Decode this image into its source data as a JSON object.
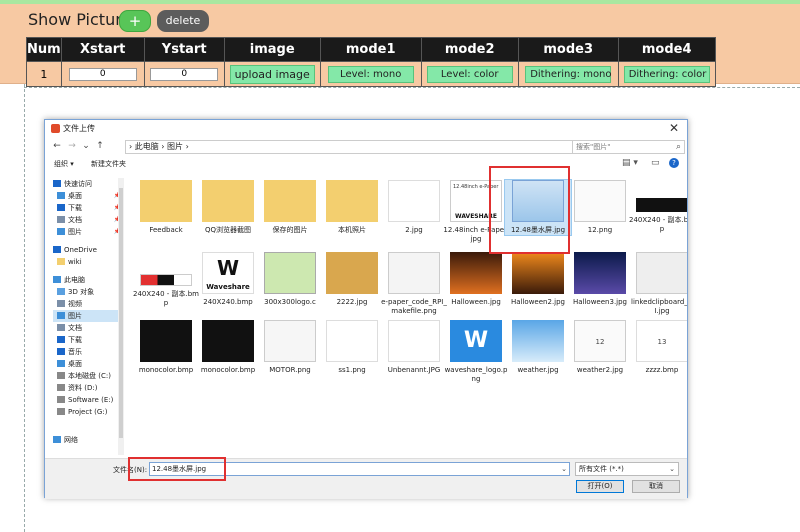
{
  "app": {
    "title": "Show Picture",
    "add_label": "+",
    "delete_label": "delete"
  },
  "table": {
    "headers": [
      "Num",
      "Xstart",
      "Ystart",
      "image",
      "mode1",
      "mode2",
      "mode3",
      "mode4"
    ],
    "row": {
      "num": "1",
      "xstart": "0",
      "ystart": "0",
      "image_btn": "upload image",
      "mode1": "Level: mono",
      "mode2": "Level: color",
      "mode3": "Dithering: mono",
      "mode4": "Dithering: color"
    }
  },
  "dialog": {
    "title": "文件上传",
    "close": "✕",
    "nav": {
      "back": "←",
      "forward": "→",
      "dropdown": "⌄",
      "up": "↑"
    },
    "address": "› 此电脑 › 图片 ›",
    "refresh": "↻",
    "search_placeholder": "搜索\"图片\"",
    "search_icon": "⌕",
    "toolbar": {
      "organize": "组织 ▾",
      "new_folder": "新建文件夹",
      "view": "▤ ▾",
      "pane": "▭",
      "help": "?"
    },
    "sidebar": [
      {
        "label": "快速访问",
        "icon": "star-icon",
        "color": "#1a66c9",
        "pin": ""
      },
      {
        "label": "桌面",
        "icon": "desktop-icon",
        "color": "#3d8fd8",
        "pin": "📌"
      },
      {
        "label": "下载",
        "icon": "download-icon",
        "color": "#1a66c9",
        "pin": "📌"
      },
      {
        "label": "文档",
        "icon": "document-icon",
        "color": "#7b8fa8",
        "pin": "📌"
      },
      {
        "label": "图片",
        "icon": "pictures-icon",
        "color": "#3d8fd8",
        "pin": "📌"
      },
      {
        "label": "OneDrive",
        "icon": "cloud-icon",
        "color": "#1a66c9",
        "pin": ""
      },
      {
        "label": "wiki",
        "icon": "folder-icon",
        "color": "#f3cf6f",
        "pin": ""
      },
      {
        "label": "此电脑",
        "icon": "computer-icon",
        "color": "#3d8fd8",
        "pin": ""
      },
      {
        "label": "3D 对象",
        "icon": "cube-icon",
        "color": "#5aa0e0",
        "pin": ""
      },
      {
        "label": "视频",
        "icon": "video-icon",
        "color": "#7b8fa8",
        "pin": ""
      },
      {
        "label": "图片",
        "icon": "pictures-icon",
        "color": "#3d8fd8",
        "pin": ""
      },
      {
        "label": "文档",
        "icon": "document-icon",
        "color": "#7b8fa8",
        "pin": ""
      },
      {
        "label": "下载",
        "icon": "download-icon",
        "color": "#1a66c9",
        "pin": ""
      },
      {
        "label": "音乐",
        "icon": "music-icon",
        "color": "#1a66c9",
        "pin": ""
      },
      {
        "label": "桌面",
        "icon": "desktop-icon",
        "color": "#3d8fd8",
        "pin": ""
      },
      {
        "label": "本地磁盘 (C:)",
        "icon": "drive-icon",
        "color": "#888888",
        "pin": ""
      },
      {
        "label": "资料 (D:)",
        "icon": "drive-icon",
        "color": "#888888",
        "pin": ""
      },
      {
        "label": "Software (E:)",
        "icon": "drive-icon",
        "color": "#888888",
        "pin": ""
      },
      {
        "label": "Project (G:)",
        "icon": "drive-icon",
        "color": "#888888",
        "pin": ""
      },
      {
        "label": "网络",
        "icon": "network-icon",
        "color": "#3d8fd8",
        "pin": ""
      }
    ],
    "files": [
      {
        "name": "Feedback",
        "kind": "folder"
      },
      {
        "name": "QQ浏览器截图",
        "kind": "folder-doc"
      },
      {
        "name": "保存的图片",
        "kind": "folder"
      },
      {
        "name": "本机照片",
        "kind": "folder-doc"
      },
      {
        "name": "2.jpg",
        "kind": "image"
      },
      {
        "name": "12.48inch e-Paper.jpg",
        "kind": "image"
      },
      {
        "name": "12.48墨水屏.jpg",
        "kind": "image"
      },
      {
        "name": "12.png",
        "kind": "image"
      },
      {
        "name": "240X240 - 副本.bmp",
        "kind": "image"
      },
      {
        "name": "240X240 - 副本.bmp",
        "kind": "image"
      },
      {
        "name": "240X240.bmp",
        "kind": "image"
      },
      {
        "name": "300x300logo.c",
        "kind": "image"
      },
      {
        "name": "2222.jpg",
        "kind": "image"
      },
      {
        "name": "e-paper_code_RPI_makefile.png",
        "kind": "image"
      },
      {
        "name": "Halloween.jpg",
        "kind": "image"
      },
      {
        "name": "Halloween2.jpg",
        "kind": "image"
      },
      {
        "name": "Halloween3.jpg",
        "kind": "image"
      },
      {
        "name": "linkedclipboard_UI.jpg",
        "kind": "image"
      },
      {
        "name": "monocolor.bmp",
        "kind": "image"
      },
      {
        "name": "monocolor.bmp",
        "kind": "image"
      },
      {
        "name": "MOTOR.png",
        "kind": "image"
      },
      {
        "name": "ss1.png",
        "kind": "image"
      },
      {
        "name": "Unbenannt.JPG",
        "kind": "image"
      },
      {
        "name": "waveshare_logo.png",
        "kind": "image"
      },
      {
        "name": "weather.jpg",
        "kind": "image"
      },
      {
        "name": "weather2.jpg",
        "kind": "image"
      },
      {
        "name": "zzzz.bmp",
        "kind": "image"
      }
    ],
    "thumb_text": {
      "epaper_header": "12.48inch e-Paper",
      "waveshare": "WAVESHARE",
      "waveshare_word": "Waveshare",
      "wv_glyph": "W",
      "ft_12": "12",
      "ft_13": "13"
    },
    "filename_label": "文件名(N):",
    "filename_value": "12.48墨水屏.jpg",
    "filename_drop": "⌄",
    "filetype_value": "所有文件 (*.*)",
    "filetype_drop": "⌄",
    "open_label": "打开(O)",
    "cancel_label": "取消"
  }
}
